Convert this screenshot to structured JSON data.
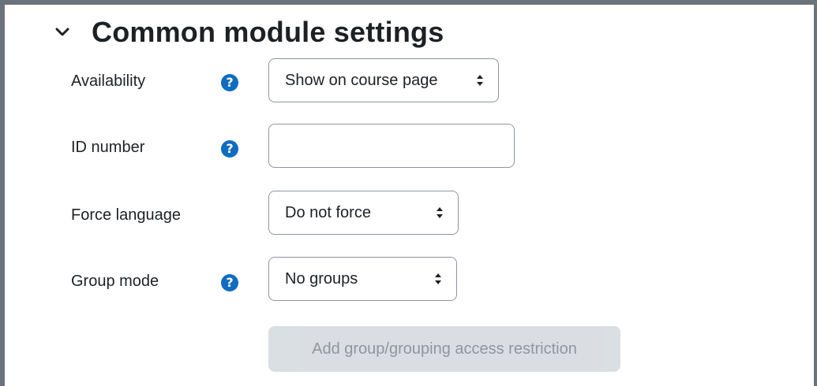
{
  "section": {
    "title": "Common module settings",
    "toggle_icon": "chevron-down-icon"
  },
  "fields": {
    "availability": {
      "label": "Availability",
      "help_glyph": "?",
      "selected": "Show on course page"
    },
    "idnumber": {
      "label": "ID number",
      "help_glyph": "?",
      "value": ""
    },
    "force_language": {
      "label": "Force language",
      "selected": "Do not force"
    },
    "group_mode": {
      "label": "Group mode",
      "help_glyph": "?",
      "selected": "No groups"
    }
  },
  "restriction_button": {
    "label": "Add group/grouping access restriction",
    "disabled": true
  },
  "colors": {
    "accent": "#0f6cbf",
    "border": "#8f959e",
    "frame": "#6a737b",
    "disabled_bg": "#ced4da"
  }
}
